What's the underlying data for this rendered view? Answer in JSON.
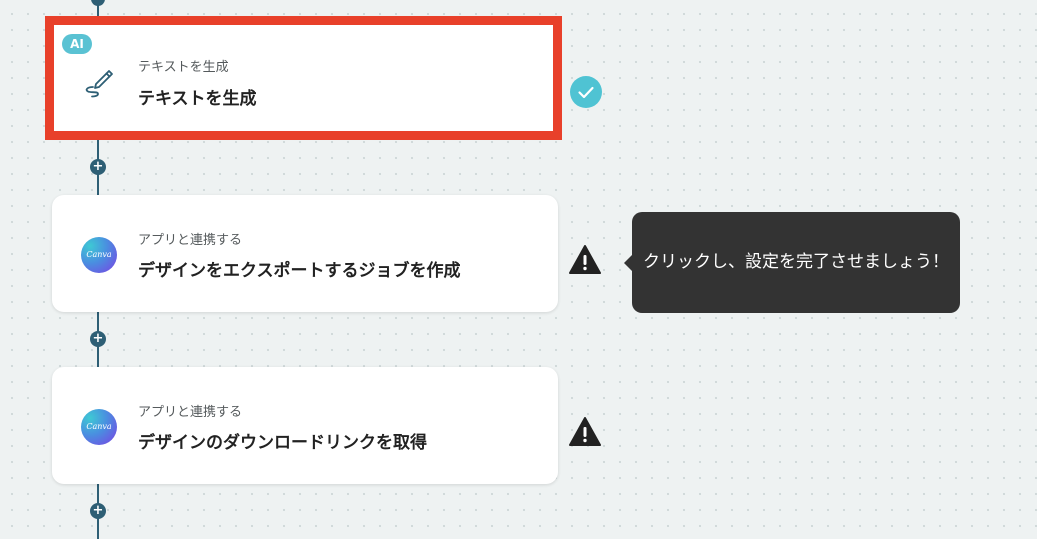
{
  "flow": {
    "add_glyph": "+",
    "steps": [
      {
        "badge": "AI",
        "subtitle": "テキストを生成",
        "title": "テキストを生成",
        "icon": "pen-signature-icon",
        "status": "complete"
      },
      {
        "logo_text": "Canva",
        "subtitle": "アプリと連携する",
        "title": "デザインをエクスポートするジョブを作成",
        "icon": "canva-logo",
        "status": "warning"
      },
      {
        "logo_text": "Canva",
        "subtitle": "アプリと連携する",
        "title": "デザインのダウンロードリンクを取得",
        "icon": "canva-logo",
        "status": "warning"
      }
    ]
  },
  "tooltip": {
    "text": "クリックし、設定を完了させましょう！"
  },
  "colors": {
    "connector": "#2e5f75",
    "selected_border": "#e8402a",
    "ai_badge": "#5ac2d3",
    "check": "#4fc3d3",
    "warning": "#222222",
    "tooltip_bg": "#333333"
  }
}
